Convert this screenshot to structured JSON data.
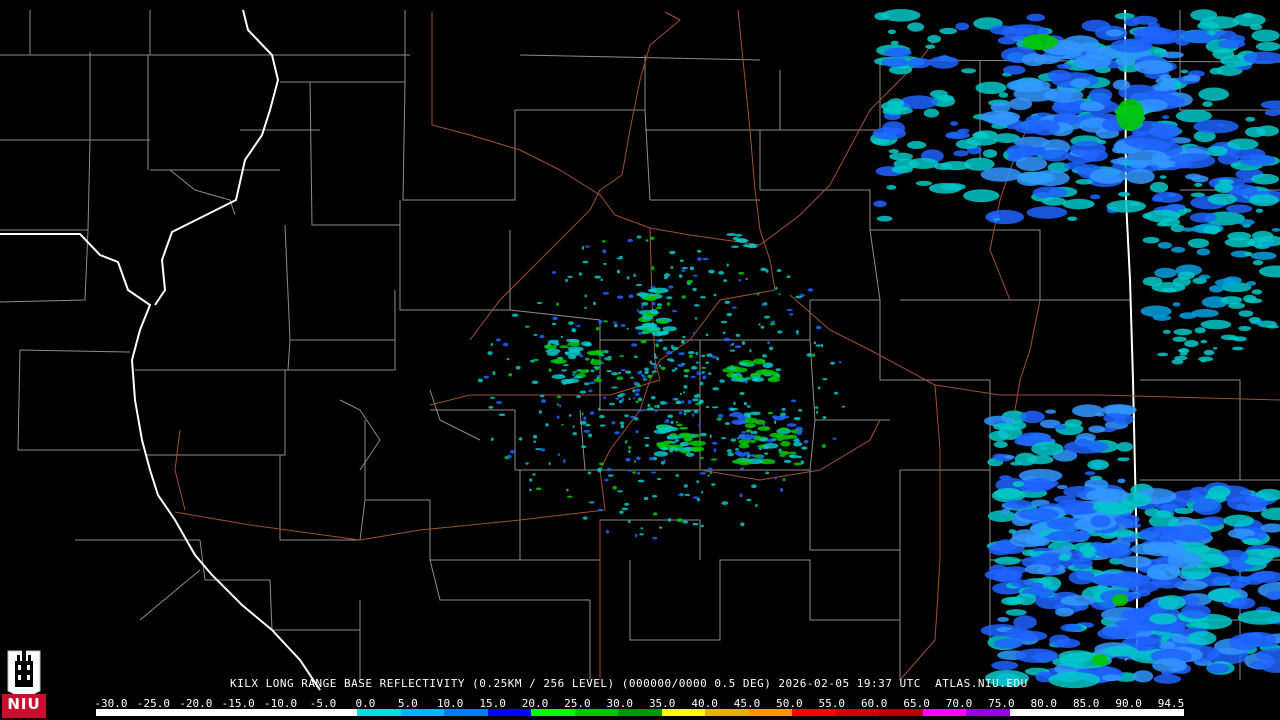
{
  "map": {
    "radar": "KILX",
    "product": "LONG RANGE BASE REFLECTIVITY",
    "caption": "KILX LONG RANGE BASE REFLECTIVITY (0.25KM / 256 LEVEL) (000000/0000 0.5 DEG) 2026-02-05 19:37 UTC  ATLAS.NIU.EDU",
    "colors": {
      "background": "#000000",
      "county_lines": "#8c8c8c",
      "state_lines": "#ffffff",
      "highways": "#a0522d",
      "echo_light": "#00c8c8",
      "echo_medium": "#1e64ff",
      "echo_strong": "#00c800"
    }
  },
  "logo": {
    "text": "NIU",
    "icon": "niu-tower-logo-icon",
    "color": "#c8102e"
  },
  "scale": {
    "labels": [
      "-30.0",
      "-25.0",
      "-20.0",
      "-15.0",
      "-10.0",
      "-5.0",
      "0.0",
      "5.0",
      "10.0",
      "15.0",
      "20.0",
      "25.0",
      "30.0",
      "35.0",
      "40.0",
      "45.0",
      "50.0",
      "55.0",
      "60.0",
      "65.0",
      "70.0",
      "75.0",
      "80.0",
      "85.0",
      "90.0",
      "94.5"
    ],
    "colors": [
      "#ffffff",
      "#ffffff",
      "#ffffff",
      "#ffffff",
      "#ffffff",
      "#ffffff",
      "#00e0e0",
      "#00b4ff",
      "#0078ff",
      "#0000ff",
      "#00ff00",
      "#00c800",
      "#009600",
      "#ffff00",
      "#e6b400",
      "#ff9600",
      "#ff0000",
      "#d20000",
      "#b40000",
      "#ff00ff",
      "#9600dc",
      "#ffffff",
      "#ffffff",
      "#ffffff",
      "#ffffff"
    ]
  }
}
